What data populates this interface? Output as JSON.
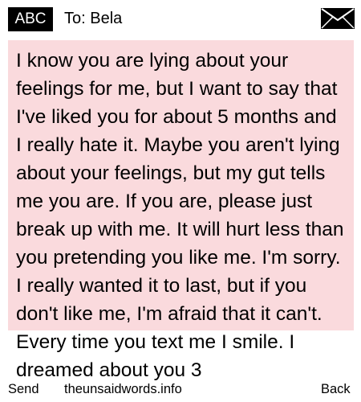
{
  "header": {
    "input_mode": "ABC",
    "to_label": "To: Bela",
    "icon": "envelope-icon"
  },
  "message": {
    "body": "I know you are lying about your feelings for me, but I want to say that I've liked you for about 5 months and I really hate it. Maybe you aren't lying about your feelings, but my gut tells me you are. If you are, please just break up with me. It will hurt less than you pretending you like me. I'm sorry. I really wanted it to last, but if you don't like me, I'm afraid that it can't. Every time you text me I smile. I dreamed about you 3",
    "background_color": "#fadadd"
  },
  "softkeys": {
    "left": "Send",
    "center": "theunsaidwords.info",
    "right": "Back"
  }
}
